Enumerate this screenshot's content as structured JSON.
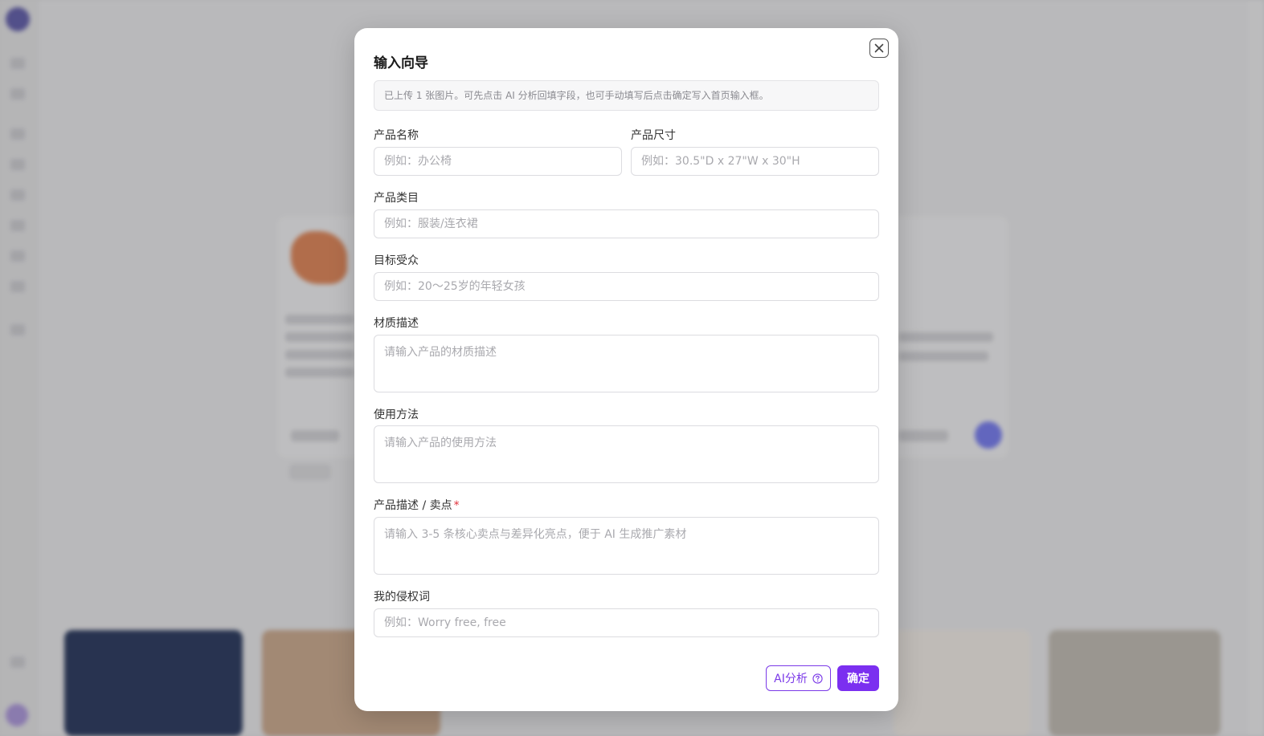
{
  "modal": {
    "title": "输入向导",
    "hint": "已上传 1 张图片。可先点击 AI 分析回填字段，也可手动填写后点击确定写入首页输入框。"
  },
  "form": {
    "product_name": {
      "label": "产品名称",
      "value": "",
      "placeholder": "例如：办公椅"
    },
    "product_size": {
      "label": "产品尺寸",
      "value": "",
      "placeholder": "例如：30.5\"D x 27\"W x 30\"H"
    },
    "product_category": {
      "label": "产品类目",
      "value": "",
      "placeholder": "例如：服装/连衣裙"
    },
    "target_audience": {
      "label": "目标受众",
      "value": "",
      "placeholder": "例如：20～25岁的年轻女孩"
    },
    "material": {
      "label": "材质描述",
      "value": "",
      "placeholder": "请输入产品的材质描述"
    },
    "usage": {
      "label": "使用方法",
      "value": "",
      "placeholder": "请输入产品的使用方法"
    },
    "selling_points": {
      "label": "产品描述 / 卖点",
      "required_mark": "*",
      "value": "",
      "placeholder": "请输入 3-5 条核心卖点与差异化亮点，便于 AI 生成推广素材"
    },
    "infringing_words": {
      "label": "我的侵权词",
      "value": "",
      "placeholder": "例如：Worry free, free"
    }
  },
  "actions": {
    "ai_label": "AI分析",
    "ai_icon": "question-circle-icon",
    "confirm_label": "确定",
    "close_icon": "close-icon"
  },
  "colors": {
    "accent": "#7b2ff0",
    "required": "#e0303a"
  }
}
